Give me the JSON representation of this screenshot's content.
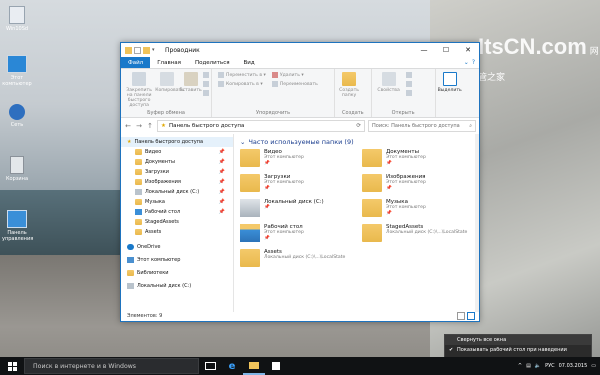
{
  "desktop": {
    "watermark": "ItsCN.com",
    "watermark_sub": "网管之家",
    "icons": [
      {
        "label": "Win10Sd"
      },
      {
        "label": "Этот компьютер"
      },
      {
        "label": "Сеть"
      },
      {
        "label": "Корзина"
      },
      {
        "label": "Панель управления"
      }
    ]
  },
  "window": {
    "title": "Проводник",
    "tabs": [
      "Файл",
      "Главная",
      "Поделиться",
      "Вид"
    ],
    "ribbon": {
      "pin_label": "Закрепить на панели быстрого доступа",
      "copy_label": "Копировать",
      "paste_label": "Вставить",
      "clipboard_group": "Буфер обмена",
      "move_to": "Переместить в ▾",
      "copy_to": "Копировать в ▾",
      "delete": "Удалить ▾",
      "rename": "Переименовать",
      "organize_group": "Упорядочить",
      "new_folder": "Создать папку",
      "new_group": "Создать",
      "properties": "Свойства",
      "open_group": "Открыть",
      "select": "Выделить"
    },
    "address": "Панель быстрого доступа",
    "search_placeholder": "Поиск: Панель быстрого доступа",
    "nav": {
      "quick_access": "Панель быстрого доступа",
      "items": [
        "Видео",
        "Документы",
        "Загрузки",
        "Изображения",
        "Локальный диск (C:)",
        "Музыка",
        "Рабочий стол",
        "StagedAssets",
        "Assets"
      ],
      "onedrive": "OneDrive",
      "this_pc": "Этот компьютер",
      "libraries": "Библиотеки",
      "local_disk": "Локальный диск (C:)"
    },
    "content": {
      "group_header": "Часто используемые папки (9)",
      "tiles": [
        {
          "name": "Видео",
          "sub": "Этот компьютер"
        },
        {
          "name": "Документы",
          "sub": "Этот компьютер"
        },
        {
          "name": "Загрузки",
          "sub": "Этот компьютер"
        },
        {
          "name": "Изображения",
          "sub": "Этот компьютер"
        },
        {
          "name": "Локальный диск (C:)",
          "sub": ""
        },
        {
          "name": "Музыка",
          "sub": "Этот компьютер"
        },
        {
          "name": "Рабочий стол",
          "sub": "Этот компьютер"
        },
        {
          "name": "StagedAssets",
          "sub": "Локальный диск (C:)\\...\\LocalState"
        },
        {
          "name": "Assets",
          "sub": "Локальный диск (C:)\\...\\LocalState"
        }
      ]
    },
    "status": "Элементов: 9"
  },
  "context_menu": {
    "item1": "Свернуть все окна",
    "item2": "Показывать рабочий стол при наведении"
  },
  "taskbar": {
    "search_placeholder": "Поиск в интернете и в Windows",
    "lang": "РУС",
    "date": "07.03.2015"
  },
  "colors": {
    "accent": "#1979ca",
    "taskbar": "#101214",
    "folder": "#f0c35a"
  }
}
